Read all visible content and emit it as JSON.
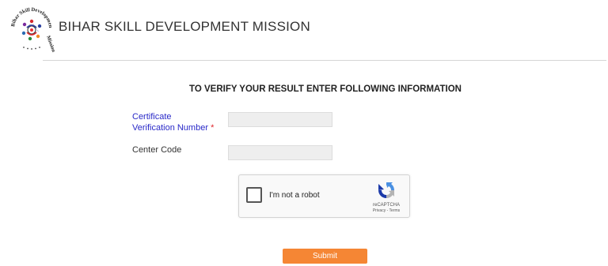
{
  "header": {
    "logo_name": "Bihar Skill Development Mission",
    "title": "BIHAR SKILL DEVELOPMENT MISSION"
  },
  "form": {
    "heading": "TO VERIFY YOUR RESULT ENTER FOLLOWING INFORMATION",
    "certificate_label_line1": "Certificate",
    "certificate_label_line2": "Verification Number",
    "required_mark": "*",
    "certificate_value": "",
    "center_code_label": "Center Code",
    "center_code_value": ""
  },
  "recaptcha": {
    "label": "I'm not a robot",
    "brand": "reCAPTCHA",
    "links": "Privacy - Terms",
    "checked": false
  },
  "submit": {
    "label": "Submit"
  },
  "colors": {
    "label_blue": "#2929c8",
    "required_red": "#e0262c",
    "submit_orange": "#f58634",
    "input_bg": "#eeeeee"
  }
}
